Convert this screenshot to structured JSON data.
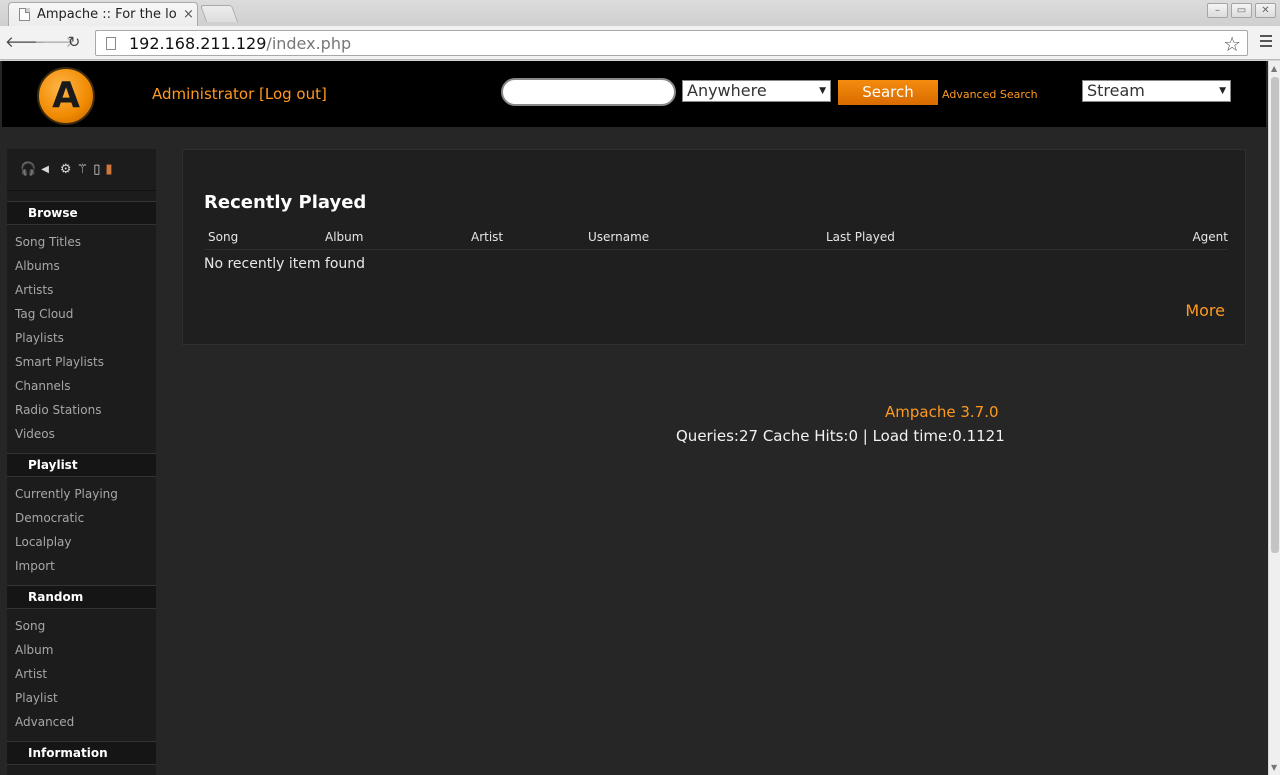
{
  "browser": {
    "tab_title": "Ampache :: For the lov",
    "tab_close": "×",
    "url_host": "192.168.211.129",
    "url_path": "/index.php",
    "window_buttons": [
      "–",
      "▭",
      "✕"
    ]
  },
  "header": {
    "logo_letter": "A",
    "user_link": "Administrator [Log out]",
    "search_placeholder": "",
    "scope_select": "Anywhere",
    "search_button": "Search",
    "advanced_search": "Advanced Search",
    "stream_select": "Stream"
  },
  "sidebar": {
    "sections": [
      {
        "title": "Browse",
        "items": [
          "Song Titles",
          "Albums",
          "Artists",
          "Tag Cloud",
          "Playlists",
          "Smart Playlists",
          "Channels",
          "Radio Stations",
          "Videos"
        ]
      },
      {
        "title": "Playlist",
        "items": [
          "Currently Playing",
          "Democratic",
          "Localplay",
          "Import"
        ]
      },
      {
        "title": "Random",
        "items": [
          "Song",
          "Album",
          "Artist",
          "Playlist",
          "Advanced"
        ]
      },
      {
        "title": "Information",
        "items": []
      }
    ],
    "icons": [
      "headphones-icon",
      "speaker-icon",
      "gear-icon",
      "wand-icon",
      "document-icon",
      "exit-door-icon"
    ]
  },
  "recently_played": {
    "title": "Recently Played",
    "columns": [
      "Song",
      "Album",
      "Artist",
      "Username",
      "Last Played",
      "Agent"
    ],
    "empty_message": "No recently item found",
    "more_link": "More"
  },
  "footer": {
    "version": "Ampache 3.7.0",
    "stats": "Queries:27 Cache Hits:0 | Load time:0.1121"
  },
  "colors": {
    "accent": "#ff9a1f",
    "background": "#262626",
    "header": "#000000"
  }
}
